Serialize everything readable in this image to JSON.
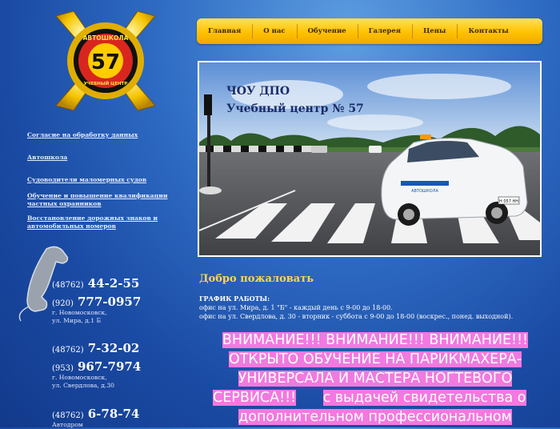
{
  "logo": {
    "text_top": "АВТОШКОЛА",
    "number": "57",
    "text_bottom": "УЧЕБНЫЙ ЦЕНТР"
  },
  "nav": {
    "items": [
      "Главная",
      "О нас",
      "Обучение",
      "Галерея",
      "Цены",
      "Контакты"
    ]
  },
  "sidebar": {
    "links": [
      "Согласие на обработку данных",
      "Автошкола",
      "Судоводители маломерных судов",
      "Обучение и повышение квалификации частных охранников",
      "Восстановление дорожных знаков и автомобильных номеров"
    ]
  },
  "hero": {
    "line1": "ЧОУ ДПО",
    "line2": "Учебный центр № 57",
    "plate": "Н 057 НН",
    "car_text": "АВТОШКОЛА"
  },
  "contacts": [
    {
      "code": "(48762)",
      "number": "44-2-55"
    },
    {
      "code": "(920)",
      "number": "777-0957",
      "address": [
        "г. Новомосковск,",
        "ул. Мира, д.1 Б"
      ]
    },
    {
      "code": "(48762)",
      "number": "7-32-02"
    },
    {
      "code": "(953)",
      "number": "967-7974",
      "address": [
        "г. Новомосковск,",
        "ул. Свердлова, д.30"
      ]
    },
    {
      "code": "(48762)",
      "number": "6-78-74",
      "address": [
        "Автодром"
      ]
    }
  ],
  "main": {
    "welcome": "Добро пожаловать",
    "schedule_title": "ГРАФИК РАБОТЫ:",
    "schedule_lines": [
      "офис на ул. Мира, д. 1 \"Б\" - каждый день с 9-00 до 18-00.",
      "офис на ул. Свердлова, д. 30 - вторник - суббота с 9-00 до 18-00 (воскрес., понед. выходной)."
    ],
    "notice_lines": [
      "ВНИМАНИЕ!!! ВНИМАНИЕ!!! ВНИМАНИЕ!!!",
      "ОТКРЫТО ОБУЧЕНИЕ НА ПАРИКМАХЕРА-",
      "УНИВЕРСАЛА И МАСТЕРА НОГТЕВОГО",
      "СЕРВИСА!!!",
      "с выдачей свидетельства о",
      "дополнительном профессиональном"
    ]
  },
  "colors": {
    "nav_gold": "#ffc200",
    "welcome_yellow": "#ffd84a",
    "notice_pink": "#f279e0",
    "hero_title": "#1a2b6a"
  }
}
